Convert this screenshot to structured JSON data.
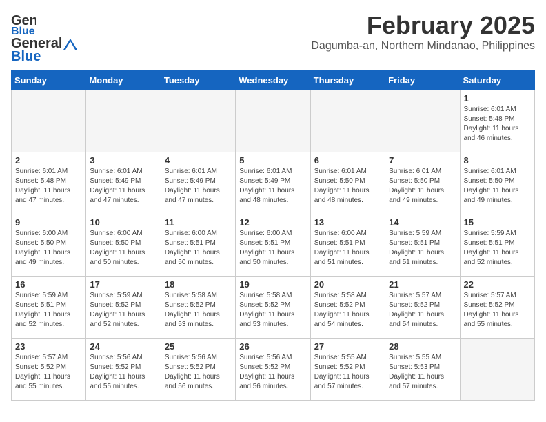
{
  "header": {
    "logo_general": "General",
    "logo_blue": "Blue",
    "title": "February 2025",
    "subtitle": "Dagumba-an, Northern Mindanao, Philippines"
  },
  "weekdays": [
    "Sunday",
    "Monday",
    "Tuesday",
    "Wednesday",
    "Thursday",
    "Friday",
    "Saturday"
  ],
  "weeks": [
    [
      {
        "day": "",
        "info": ""
      },
      {
        "day": "",
        "info": ""
      },
      {
        "day": "",
        "info": ""
      },
      {
        "day": "",
        "info": ""
      },
      {
        "day": "",
        "info": ""
      },
      {
        "day": "",
        "info": ""
      },
      {
        "day": "1",
        "info": "Sunrise: 6:01 AM\nSunset: 5:48 PM\nDaylight: 11 hours and 46 minutes."
      }
    ],
    [
      {
        "day": "2",
        "info": "Sunrise: 6:01 AM\nSunset: 5:48 PM\nDaylight: 11 hours and 47 minutes."
      },
      {
        "day": "3",
        "info": "Sunrise: 6:01 AM\nSunset: 5:49 PM\nDaylight: 11 hours and 47 minutes."
      },
      {
        "day": "4",
        "info": "Sunrise: 6:01 AM\nSunset: 5:49 PM\nDaylight: 11 hours and 47 minutes."
      },
      {
        "day": "5",
        "info": "Sunrise: 6:01 AM\nSunset: 5:49 PM\nDaylight: 11 hours and 48 minutes."
      },
      {
        "day": "6",
        "info": "Sunrise: 6:01 AM\nSunset: 5:50 PM\nDaylight: 11 hours and 48 minutes."
      },
      {
        "day": "7",
        "info": "Sunrise: 6:01 AM\nSunset: 5:50 PM\nDaylight: 11 hours and 49 minutes."
      },
      {
        "day": "8",
        "info": "Sunrise: 6:01 AM\nSunset: 5:50 PM\nDaylight: 11 hours and 49 minutes."
      }
    ],
    [
      {
        "day": "9",
        "info": "Sunrise: 6:00 AM\nSunset: 5:50 PM\nDaylight: 11 hours and 49 minutes."
      },
      {
        "day": "10",
        "info": "Sunrise: 6:00 AM\nSunset: 5:50 PM\nDaylight: 11 hours and 50 minutes."
      },
      {
        "day": "11",
        "info": "Sunrise: 6:00 AM\nSunset: 5:51 PM\nDaylight: 11 hours and 50 minutes."
      },
      {
        "day": "12",
        "info": "Sunrise: 6:00 AM\nSunset: 5:51 PM\nDaylight: 11 hours and 50 minutes."
      },
      {
        "day": "13",
        "info": "Sunrise: 6:00 AM\nSunset: 5:51 PM\nDaylight: 11 hours and 51 minutes."
      },
      {
        "day": "14",
        "info": "Sunrise: 5:59 AM\nSunset: 5:51 PM\nDaylight: 11 hours and 51 minutes."
      },
      {
        "day": "15",
        "info": "Sunrise: 5:59 AM\nSunset: 5:51 PM\nDaylight: 11 hours and 52 minutes."
      }
    ],
    [
      {
        "day": "16",
        "info": "Sunrise: 5:59 AM\nSunset: 5:51 PM\nDaylight: 11 hours and 52 minutes."
      },
      {
        "day": "17",
        "info": "Sunrise: 5:59 AM\nSunset: 5:52 PM\nDaylight: 11 hours and 52 minutes."
      },
      {
        "day": "18",
        "info": "Sunrise: 5:58 AM\nSunset: 5:52 PM\nDaylight: 11 hours and 53 minutes."
      },
      {
        "day": "19",
        "info": "Sunrise: 5:58 AM\nSunset: 5:52 PM\nDaylight: 11 hours and 53 minutes."
      },
      {
        "day": "20",
        "info": "Sunrise: 5:58 AM\nSunset: 5:52 PM\nDaylight: 11 hours and 54 minutes."
      },
      {
        "day": "21",
        "info": "Sunrise: 5:57 AM\nSunset: 5:52 PM\nDaylight: 11 hours and 54 minutes."
      },
      {
        "day": "22",
        "info": "Sunrise: 5:57 AM\nSunset: 5:52 PM\nDaylight: 11 hours and 55 minutes."
      }
    ],
    [
      {
        "day": "23",
        "info": "Sunrise: 5:57 AM\nSunset: 5:52 PM\nDaylight: 11 hours and 55 minutes."
      },
      {
        "day": "24",
        "info": "Sunrise: 5:56 AM\nSunset: 5:52 PM\nDaylight: 11 hours and 55 minutes."
      },
      {
        "day": "25",
        "info": "Sunrise: 5:56 AM\nSunset: 5:52 PM\nDaylight: 11 hours and 56 minutes."
      },
      {
        "day": "26",
        "info": "Sunrise: 5:56 AM\nSunset: 5:52 PM\nDaylight: 11 hours and 56 minutes."
      },
      {
        "day": "27",
        "info": "Sunrise: 5:55 AM\nSunset: 5:52 PM\nDaylight: 11 hours and 57 minutes."
      },
      {
        "day": "28",
        "info": "Sunrise: 5:55 AM\nSunset: 5:53 PM\nDaylight: 11 hours and 57 minutes."
      },
      {
        "day": "",
        "info": ""
      }
    ]
  ]
}
